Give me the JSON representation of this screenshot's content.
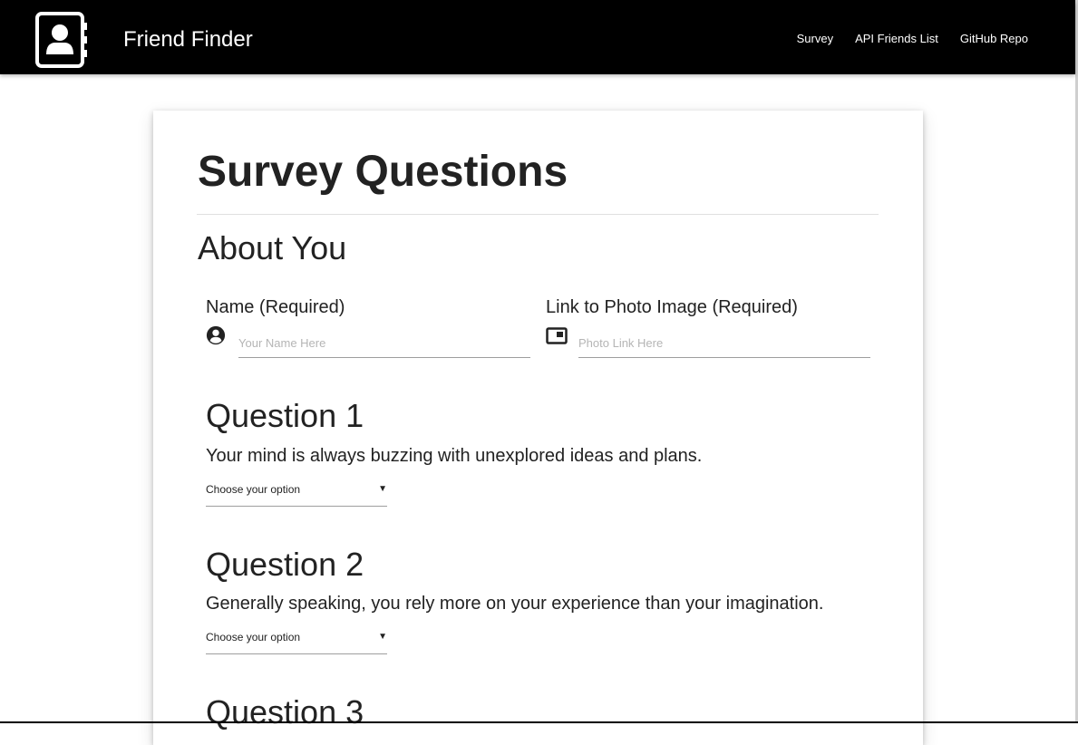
{
  "navbar": {
    "brand": "Friend Finder",
    "logo_icon": "contact-book-icon",
    "links": [
      {
        "label": "Survey"
      },
      {
        "label": "API Friends List"
      },
      {
        "label": "GitHub Repo"
      }
    ]
  },
  "survey": {
    "title": "Survey Questions",
    "about_title": "About You",
    "name_field": {
      "label": "Name (Required)",
      "placeholder": "Your Name Here",
      "value": "",
      "icon": "account-circle-icon"
    },
    "photo_field": {
      "label": "Link to Photo Image (Required)",
      "placeholder": "Photo Link Here",
      "value": "",
      "icon": "picture-in-picture-icon"
    },
    "questions": [
      {
        "title": "Question 1",
        "text": "Your mind is always buzzing with unexplored ideas and plans.",
        "select_value": "Choose your option"
      },
      {
        "title": "Question 2",
        "text": "Generally speaking, you rely more on your experience than your imagination.",
        "select_value": "Choose your option"
      },
      {
        "title": "Question 3"
      }
    ],
    "caret": "▼"
  }
}
